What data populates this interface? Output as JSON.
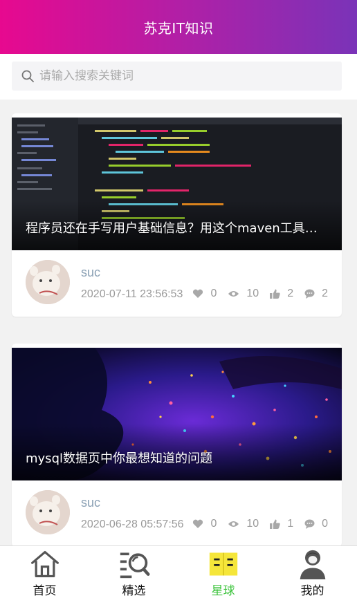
{
  "header": {
    "title": "苏克IT知识"
  },
  "search": {
    "placeholder": "请输入搜索关键词"
  },
  "articles": [
    {
      "title": "程序员还在手写用户基础信息？用这个maven工具…",
      "author": "suc",
      "date": "2020-07-11 23:56:53",
      "likes": "0",
      "views": "10",
      "thumbs": "2",
      "comments": "2"
    },
    {
      "title": "mysql数据页中你最想知道的问题",
      "author": "suc",
      "date": "2020-06-28 05:57:56",
      "likes": "0",
      "views": "10",
      "thumbs": "1",
      "comments": "0"
    }
  ],
  "tabbar": {
    "items": [
      {
        "label": "首页",
        "icon": "home-icon"
      },
      {
        "label": "精选",
        "icon": "search-list-icon"
      },
      {
        "label": "星球",
        "icon": "book-icon",
        "active": true
      },
      {
        "label": "我的",
        "icon": "profile-icon"
      }
    ]
  },
  "colors": {
    "active_tab": "#3ec43e",
    "header_start": "#e7098f",
    "header_end": "#7a33b8"
  }
}
